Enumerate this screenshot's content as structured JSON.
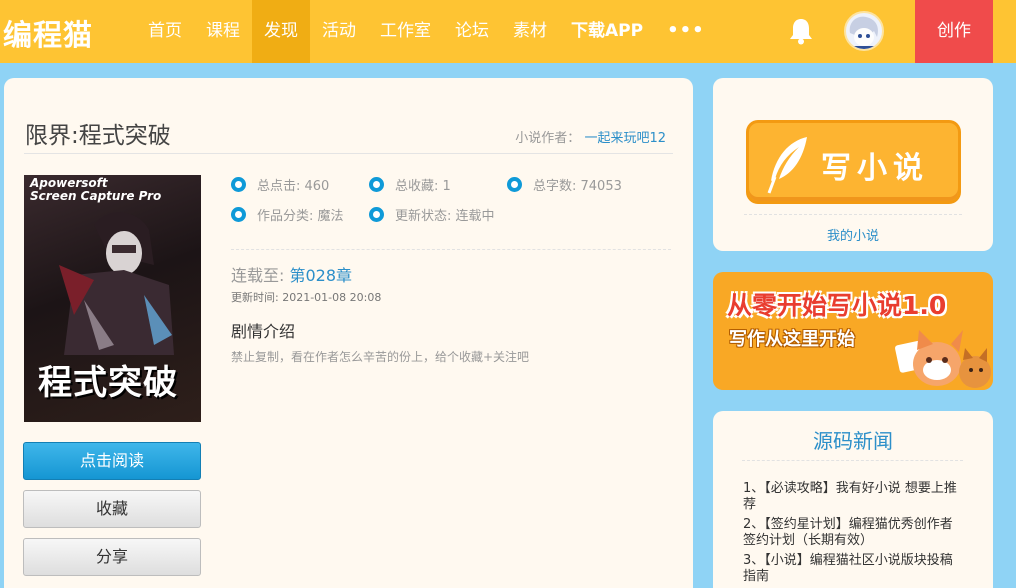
{
  "header": {
    "logo": "编程猫",
    "nav": [
      {
        "label": "首页",
        "active": false
      },
      {
        "label": "课程",
        "active": false
      },
      {
        "label": "发现",
        "active": true
      },
      {
        "label": "活动",
        "active": false
      },
      {
        "label": "工作室",
        "active": false
      },
      {
        "label": "论坛",
        "active": false
      },
      {
        "label": "素材",
        "active": false
      },
      {
        "label": "下载APP",
        "active": false
      }
    ],
    "more_label": "•••",
    "create_label": "创作",
    "colors": {
      "bar": "#fec433",
      "active_tab": "#f0ad14",
      "create": "#f04b4b"
    }
  },
  "book": {
    "title": "限界:程式突破",
    "author_label": "小说作者：",
    "author_name": "一起来玩吧12",
    "cover": {
      "top_text_1": "Apowersoft",
      "top_text_2": "Screen Capture Pro",
      "title_text": "程式突破"
    },
    "stats": {
      "clicks": "总点击: 460",
      "favorites": "总收藏: 1",
      "words": "总字数: 74053",
      "category": "作品分类: 魔法",
      "status": "更新状态: 连载中"
    },
    "serial_label": "连载至:",
    "serial_chapter": "第028章",
    "update_time": "更新时间: 2021-01-08 20:08",
    "synopsis_title": "剧情介绍",
    "synopsis_text": "禁止复制，看在作者怎么辛苦的份上，给个收藏+关注吧"
  },
  "actions": {
    "read": "点击阅读",
    "favorite": "收藏",
    "share": "分享"
  },
  "sidebar": {
    "write_label": "写小说",
    "my_novel_label": "我的小说",
    "banner_title": "从零开始写小说1.0",
    "banner_subtitle": "写作从这里开始",
    "news_heading": "源码新闻",
    "news": [
      "1、【必读攻略】我有好小说 想要上推荐",
      "2、【签约星计划】编程猫优秀创作者签约计划（长期有效）",
      "3、【小说】编程猫社区小说版块投稿指南"
    ]
  }
}
